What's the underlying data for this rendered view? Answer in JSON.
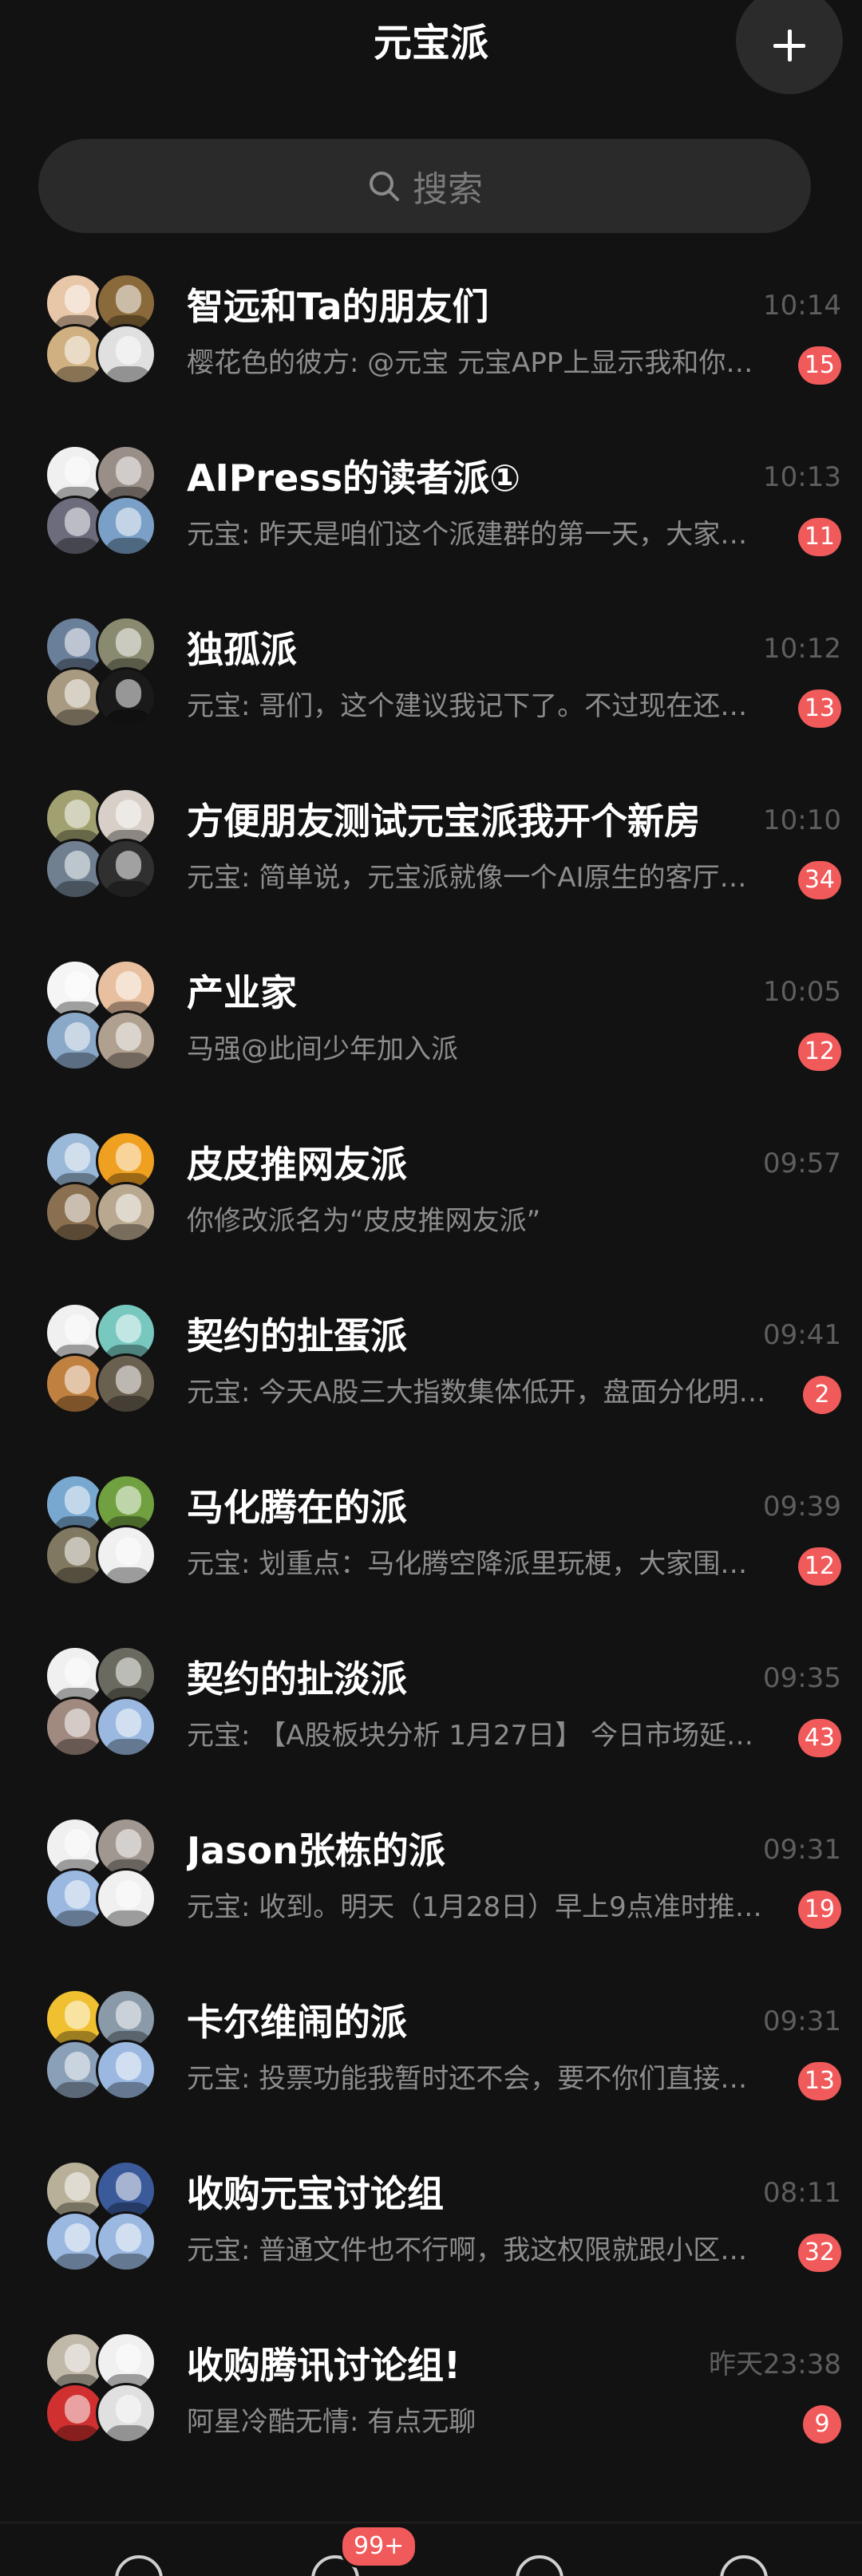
{
  "header": {
    "title": "元宝派"
  },
  "search": {
    "placeholder": "搜索"
  },
  "chats": [
    {
      "title": "智远和Ta的朋友们",
      "time": "10:14",
      "message": "樱花色的彼方: @元宝 元宝APP上显示我和你…",
      "badge": "15",
      "avatar_colors": [
        "#e8c6a8",
        "#8a6a3a",
        "#d0b080",
        "#e0e0e0"
      ]
    },
    {
      "title": "AIPress的读者派①",
      "time": "10:13",
      "message": "元宝: 昨天是咱们这个派建群的第一天，大家…",
      "badge": "11",
      "avatar_colors": [
        "#f0f0f0",
        "#9a8f88",
        "#6c6c7c",
        "#7aa0c8"
      ]
    },
    {
      "title": "独孤派",
      "time": "10:12",
      "message": "元宝: 哥们，这个建议我记下了。不过现在还…",
      "badge": "13",
      "avatar_colors": [
        "#6a7f9a",
        "#8a8a70",
        "#a89a80",
        "#1a1a1a"
      ]
    },
    {
      "title": "方便朋友测试元宝派我开个新房间",
      "time": "10:10",
      "message": "元宝: 简单说，元宝派就像一个AI原生的客厅…",
      "badge": "34",
      "avatar_colors": [
        "#a0a070",
        "#d8d0c8",
        "#708090",
        "#303030"
      ]
    },
    {
      "title": "产业家",
      "time": "10:05",
      "message": "马强@此间少年加入派",
      "badge": "12",
      "avatar_colors": [
        "#f5f5f5",
        "#e8c0a0",
        "#8aa8c8",
        "#b0a090"
      ]
    },
    {
      "title": "皮皮推网友派",
      "time": "09:57",
      "message": "你修改派名为“皮皮推网友派”",
      "badge": "",
      "avatar_colors": [
        "#9ab8d8",
        "#f0a020",
        "#8a7050",
        "#b8a890"
      ]
    },
    {
      "title": "契约的扯蛋派",
      "time": "09:41",
      "message": "元宝: 今天A股三大指数集体低开，盘面分化明…",
      "badge": "2",
      "avatar_colors": [
        "#f0f0f0",
        "#78c8c0",
        "#c08040",
        "#6a6050"
      ]
    },
    {
      "title": "马化腾在的派",
      "time": "09:39",
      "message": "元宝: 划重点：马化腾空降派里玩梗，大家围…",
      "badge": "12",
      "avatar_colors": [
        "#78a8d0",
        "#70a040",
        "#807860",
        "#f0f0f0"
      ]
    },
    {
      "title": "契约的扯淡派",
      "time": "09:35",
      "message": "元宝: 【A股板块分析 1月27日】 今日市场延…",
      "badge": "43",
      "avatar_colors": [
        "#f0f0f0",
        "#6a6a60",
        "#a08a80",
        "#9ab8e0"
      ]
    },
    {
      "title": "Jason张栋的派",
      "time": "09:31",
      "message": "元宝: 收到。明天（1月28日）早上9点准时推…",
      "badge": "19",
      "avatar_colors": [
        "#f0f0f0",
        "#a09890",
        "#9ab8e0",
        "#f0f0f0"
      ]
    },
    {
      "title": "卡尔维闹的派",
      "time": "09:31",
      "message": "元宝: 投票功能我暂时还不会，要不你们直接…",
      "badge": "13",
      "avatar_colors": [
        "#f0c030",
        "#8a9aa8",
        "#8aa0b8",
        "#9ab8e0"
      ]
    },
    {
      "title": "收购元宝讨论组",
      "time": "08:11",
      "message": "元宝: 普通文件也不行啊，我这权限就跟小区…",
      "badge": "32",
      "avatar_colors": [
        "#b8b098",
        "#3a5a9a",
        "#9ab8e0",
        "#9ab8e0"
      ]
    },
    {
      "title": "收购腾讯讨论组!",
      "time": "昨天23:38",
      "message": "阿星冷酷无情: 有点无聊",
      "badge": "9",
      "avatar_colors": [
        "#c0b8a8",
        "#f0f0f0",
        "#d03030",
        "#e0e0e0"
      ]
    }
  ],
  "tabbar": {
    "badge": "99+"
  },
  "colors": {
    "background": "#121212",
    "badge": "#f05a5a",
    "search_bg": "#2a2a2a"
  }
}
